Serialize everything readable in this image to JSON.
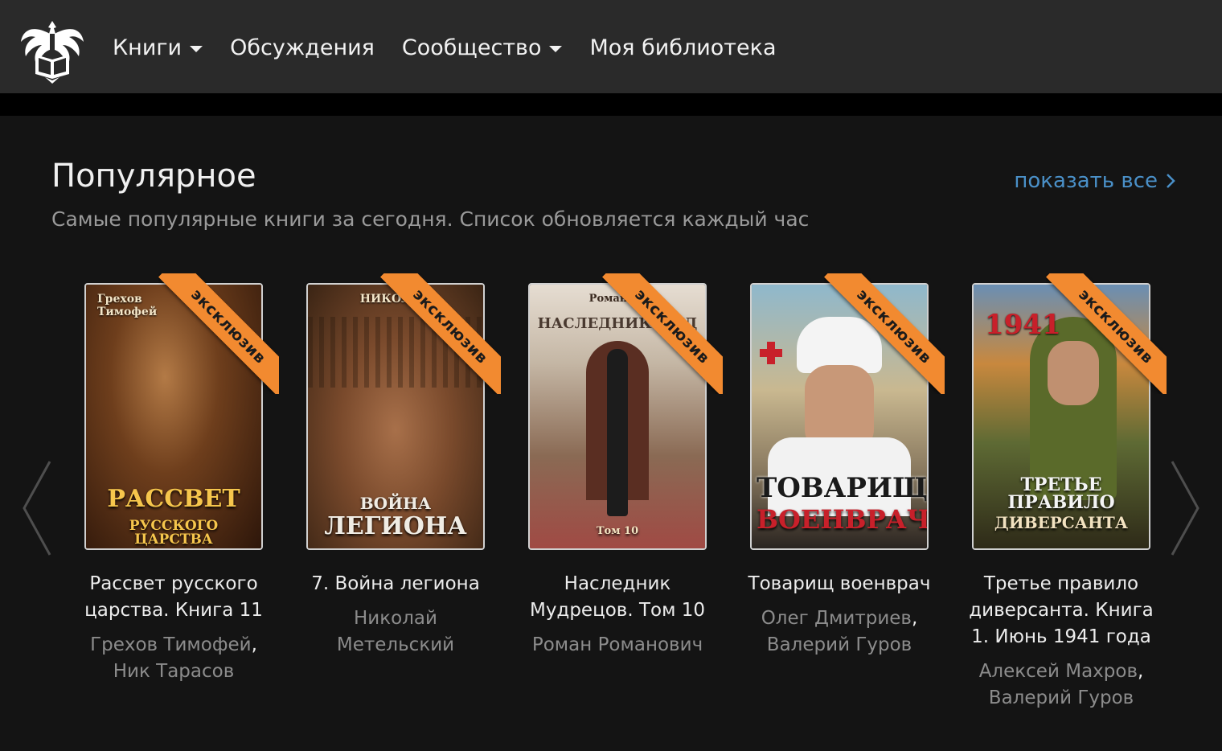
{
  "nav": {
    "logo_icon": "eagle-book-logo",
    "items": [
      {
        "label": "Книги",
        "has_dropdown": true
      },
      {
        "label": "Обсуждения",
        "has_dropdown": false
      },
      {
        "label": "Сообщество",
        "has_dropdown": true
      },
      {
        "label": "Моя библиотека",
        "has_dropdown": false
      }
    ]
  },
  "section": {
    "title": "Популярное",
    "subtitle": "Самые популярные книги за сегодня. Список обновляется каждый час",
    "show_all": "показать все",
    "accent_color": "#4a90c8"
  },
  "badge_label": "эксклюзив",
  "badge_color": "#f28a30",
  "carousel": {
    "prev_icon": "chevron-left-icon",
    "next_icon": "chevron-right-icon"
  },
  "books": [
    {
      "title": "Рассвет русского царства. Книга 11",
      "author_line1": "Грехов Тимофей",
      "separator": ",",
      "author_line2": "Ник Тарасов",
      "cover_text_top": "Грехов Тимофей",
      "cover_text_main": "РАССВЕТ",
      "cover_text_sub": "РУССКОГО ЦАРСТВА"
    },
    {
      "title": "7. Война легиона",
      "author_line1": "Николай",
      "separator": "",
      "author_line2": "Метельский",
      "cover_text_top": "НИКОЛАЙ",
      "cover_text_main": "ВОЙНА",
      "cover_text_sub": "ЛЕГИОНА"
    },
    {
      "title": "Наследник Мудрецов. Том 10",
      "author_line1": "Роман Романович",
      "separator": "",
      "author_line2": "",
      "cover_text_top": "Роман Ро",
      "cover_text_main": "НАСЛЕДНИК МУД",
      "cover_text_sub": "Том 10"
    },
    {
      "title": "Товарищ военврач",
      "author_line1": "Олег Дмитриев",
      "separator": ",",
      "author_line2": "Валерий Гуров",
      "cover_text_top": "",
      "cover_text_main": "ТОВАРИЩ",
      "cover_text_sub": "ВОЕНВРАЧ"
    },
    {
      "title": "Третье правило диверсанта. Книга 1. Июнь 1941 года",
      "author_line1": "Алексей Махров",
      "separator": ",",
      "author_line2": "Валерий Гуров",
      "cover_text_top": "1941",
      "cover_text_main": "ТРЕТЬЕ ПРАВИЛО",
      "cover_text_sub": "ДИВЕРСАНТА"
    }
  ]
}
